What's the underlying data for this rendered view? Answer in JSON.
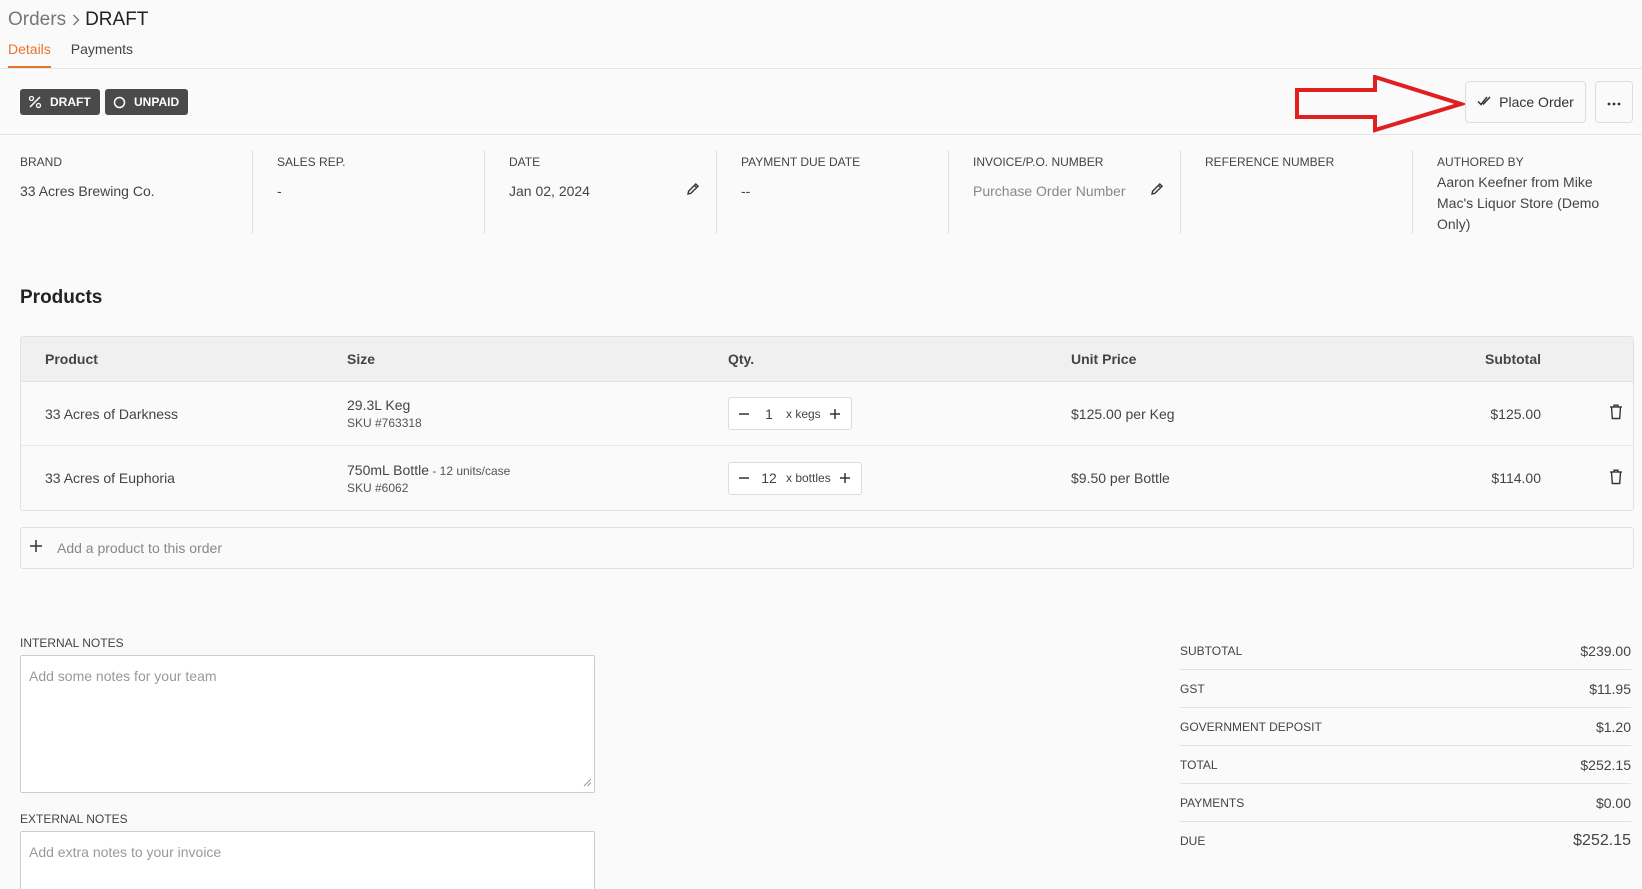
{
  "breadcrumb": {
    "root": "Orders",
    "current": "DRAFT"
  },
  "tabs": [
    {
      "label": "Details",
      "active": true
    },
    {
      "label": "Payments",
      "active": false
    }
  ],
  "status_badges": {
    "draft": "DRAFT",
    "unpaid": "UNPAID"
  },
  "actions": {
    "place_order": "Place Order"
  },
  "clipped_heading": "Details",
  "details": {
    "brand": {
      "label": "BRAND",
      "value": "33 Acres Brewing Co."
    },
    "sales_rep": {
      "label": "SALES REP.",
      "value": "-"
    },
    "date": {
      "label": "DATE",
      "value": "Jan 02, 2024"
    },
    "payment_due": {
      "label": "PAYMENT DUE DATE",
      "value": "--"
    },
    "invoice": {
      "label": "INVOICE/P.O. NUMBER",
      "placeholder": "Purchase Order Number"
    },
    "reference": {
      "label": "REFERENCE NUMBER",
      "value": ""
    },
    "authored_by": {
      "label": "AUTHORED BY",
      "value": "Aaron Keefner from Mike Mac's Liquor Store (Demo Only)"
    }
  },
  "products": {
    "title": "Products",
    "columns": {
      "product": "Product",
      "size": "Size",
      "qty": "Qty.",
      "unit_price": "Unit Price",
      "subtotal": "Subtotal"
    },
    "rows": [
      {
        "name": "33 Acres of Darkness",
        "size": "29.3L Keg",
        "case_info": "",
        "sku": "SKU #763318",
        "qty": "1",
        "unit": "x kegs",
        "unit_price": "$125.00 per Keg",
        "subtotal": "$125.00"
      },
      {
        "name": "33 Acres of Euphoria",
        "size": "750mL Bottle",
        "case_info": " - 12 units/case",
        "sku": "SKU #6062",
        "qty": "12",
        "unit": "x bottles",
        "unit_price": "$9.50 per Bottle",
        "subtotal": "$114.00"
      }
    ],
    "add_label": "Add a product to this order"
  },
  "notes": {
    "internal": {
      "label": "INTERNAL NOTES",
      "placeholder": "Add some notes for your team"
    },
    "external": {
      "label": "EXTERNAL NOTES",
      "placeholder": "Add extra notes to your invoice"
    }
  },
  "summary": {
    "subtotal": {
      "label": "SUBTOTAL",
      "value": "$239.00"
    },
    "gst": {
      "label": "GST",
      "value": "$11.95"
    },
    "deposit": {
      "label": "GOVERNMENT DEPOSIT",
      "value": "$1.20"
    },
    "total": {
      "label": "TOTAL",
      "value": "$252.15"
    },
    "payments": {
      "label": "PAYMENTS",
      "value": "$0.00"
    },
    "due": {
      "label": "DUE",
      "value": "$252.15"
    }
  },
  "colors": {
    "accent": "#e8742a",
    "badge_bg": "#4a4a4a",
    "annotation_arrow": "#e02020"
  },
  "icons": [
    "chevron-right-icon",
    "percent-icon",
    "circle-icon",
    "double-check-icon",
    "ellipsis-icon",
    "pencil-icon",
    "minus-icon",
    "plus-icon",
    "trash-icon",
    "resize-grip-icon",
    "red-arrow-annotation"
  ]
}
